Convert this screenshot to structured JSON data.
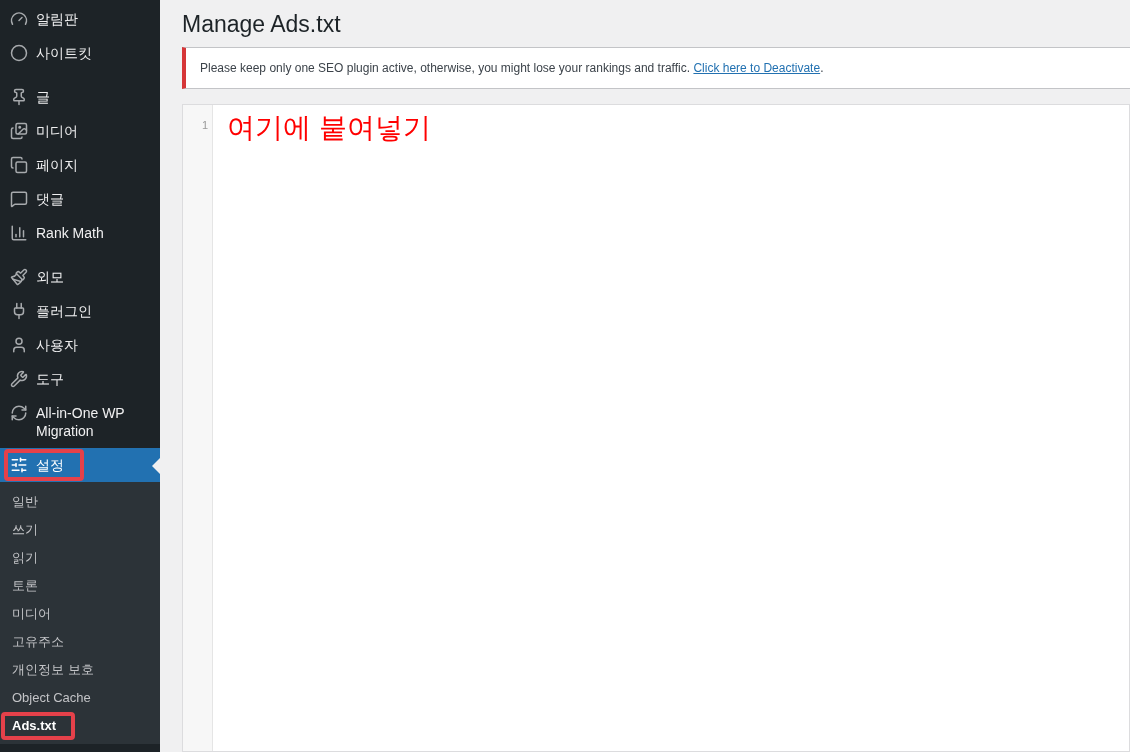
{
  "sidebar": {
    "groups": [
      [
        {
          "label": "알림판"
        },
        {
          "label": "사이트킷"
        }
      ],
      [
        {
          "label": "글"
        },
        {
          "label": "미디어"
        },
        {
          "label": "페이지"
        },
        {
          "label": "댓글"
        },
        {
          "label": "Rank Math"
        }
      ],
      [
        {
          "label": "외모"
        },
        {
          "label": "플러그인"
        },
        {
          "label": "사용자"
        },
        {
          "label": "도구"
        },
        {
          "label": "All-in-One WP Migration"
        },
        {
          "label": "설정",
          "selected": true,
          "highlighted": true,
          "submenu": [
            {
              "label": "일반",
              "selected": false,
              "highlighted": false
            },
            {
              "label": "쓰기",
              "selected": false,
              "highlighted": false
            },
            {
              "label": "읽기",
              "selected": false,
              "highlighted": false
            },
            {
              "label": "토론",
              "selected": false,
              "highlighted": false
            },
            {
              "label": "미디어",
              "selected": false,
              "highlighted": false
            },
            {
              "label": "고유주소",
              "selected": false,
              "highlighted": false
            },
            {
              "label": "개인정보 보호",
              "selected": false,
              "highlighted": false
            },
            {
              "label": "Object Cache",
              "selected": false,
              "highlighted": false
            },
            {
              "label": "Ads.txt",
              "selected": true,
              "highlighted": true
            }
          ]
        }
      ]
    ]
  },
  "page": {
    "title": "Manage Ads.txt",
    "notice": {
      "text": "Please keep only one SEO plugin active, otherwise, you might lose your rankings and traffic.",
      "link": "Click here to Deactivate",
      "after": "."
    },
    "editor": {
      "lines": [
        {
          "number": "1",
          "text": "여기에 붙여넣기"
        }
      ]
    }
  }
}
